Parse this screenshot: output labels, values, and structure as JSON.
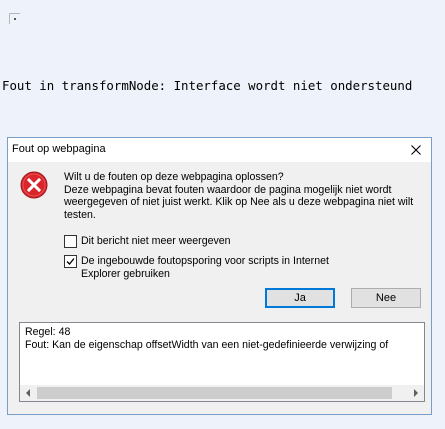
{
  "page": {
    "error_text": "Fout in transformNode: Interface wordt niet ondersteund"
  },
  "dialog": {
    "title": "Fout op webpagina",
    "message_lines": [
      "Wilt u de fouten op deze webpagina oplossen?",
      "Deze webpagina bevat fouten waardoor de pagina mogelijk niet wordt",
      "weergegeven of niet juist werkt. Klik op Nee als u deze webpagina niet wilt",
      "testen."
    ],
    "checkbox_dont_show": {
      "label": "Dit bericht niet meer weergeven",
      "checked": false
    },
    "checkbox_debugging": {
      "label_lines": [
        "De ingebouwde foutopsporing voor scripts in Internet",
        "Explorer gebruiken"
      ],
      "checked": true
    },
    "yes_label": "Ja",
    "no_label": "Nee",
    "details": {
      "line1": "Regel: 48",
      "line2": "Fout: Kan de eigenschap offsetWidth van een niet-gedefinieerde verwijzing of"
    }
  },
  "icons": {
    "close": "close-icon",
    "error": "error-icon",
    "check": "checkmark-icon",
    "scroll_left": "scroll-left-arrow-icon",
    "scroll_right": "scroll-right-arrow-icon"
  },
  "colors": {
    "error_red": "#d9262c",
    "default_button_border": "#0078d7",
    "dialog_border": "#7a9cc8"
  }
}
